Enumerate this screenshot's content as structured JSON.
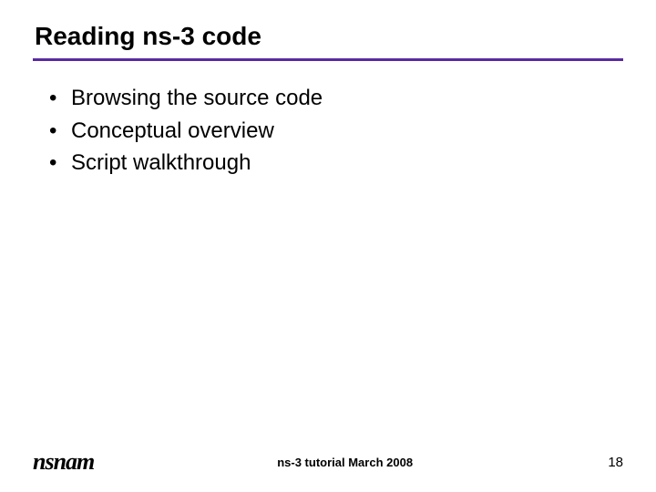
{
  "title": "Reading ns-3 code",
  "bullets": [
    "Browsing the source code",
    "Conceptual overview",
    "Script walkthrough"
  ],
  "footer": {
    "logo": "nsnam",
    "text": "ns-3 tutorial March 2008",
    "page": "18"
  },
  "colors": {
    "accent": "#5a2aa0"
  }
}
